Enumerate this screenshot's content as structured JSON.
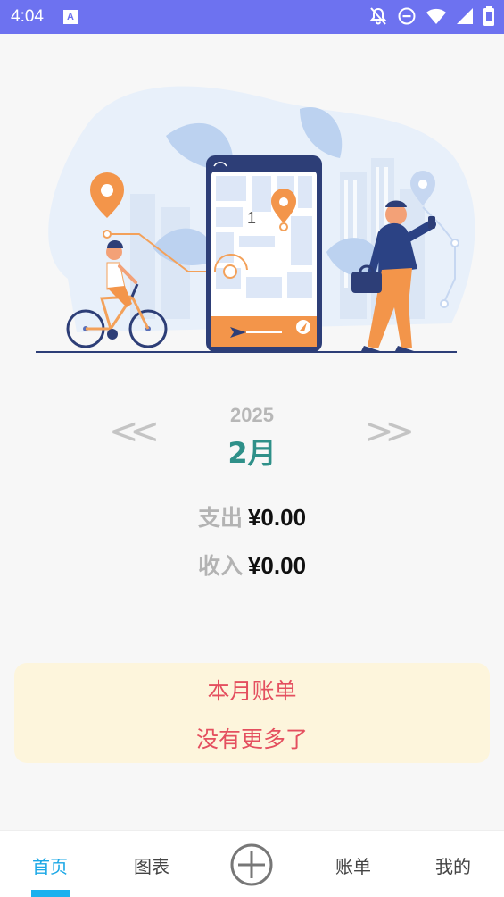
{
  "status_bar": {
    "time": "4:04",
    "notification_icon": "A",
    "icons": [
      "bell-off-icon",
      "do-not-disturb-icon",
      "wifi-icon",
      "signal-icon",
      "battery-icon"
    ],
    "background": "#6d72f0"
  },
  "hero": {
    "illustration": "city-navigation-illustration",
    "map_marker_text": "1"
  },
  "month_nav": {
    "prev_label": "<<",
    "next_label": ">>",
    "year": "2025",
    "month": "2月"
  },
  "summary": {
    "expense_label": "支出",
    "expense_value": "¥0.00",
    "income_label": "收入",
    "income_value": "¥0.00"
  },
  "bill_card": {
    "title": "本月账单",
    "empty_text": "没有更多了"
  },
  "tab_bar": {
    "home": "首页",
    "chart": "图表",
    "add_icon": "plus-circle-icon",
    "bills": "账单",
    "mine": "我的",
    "active_color": "#1aa7e6"
  },
  "colors": {
    "month": "#2f9089",
    "bill_text": "#e44f5f",
    "bill_background": "#fdf5dc"
  }
}
